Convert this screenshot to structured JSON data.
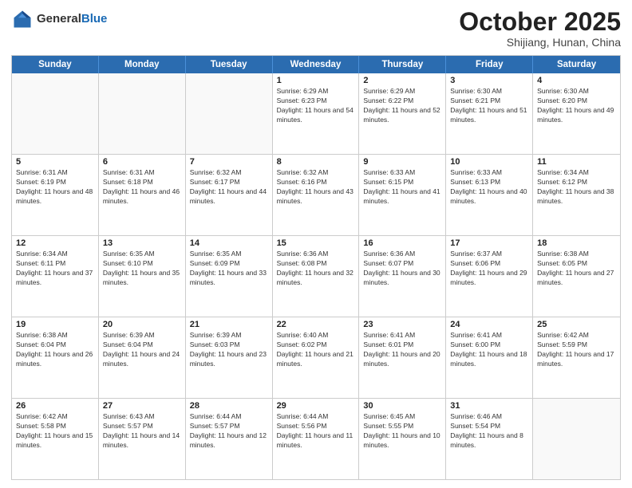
{
  "header": {
    "logo_general": "General",
    "logo_blue": "Blue",
    "month_title": "October 2025",
    "location": "Shijiang, Hunan, China"
  },
  "weekdays": [
    "Sunday",
    "Monday",
    "Tuesday",
    "Wednesday",
    "Thursday",
    "Friday",
    "Saturday"
  ],
  "rows": [
    [
      {
        "day": "",
        "sunrise": "",
        "sunset": "",
        "daylight": ""
      },
      {
        "day": "",
        "sunrise": "",
        "sunset": "",
        "daylight": ""
      },
      {
        "day": "",
        "sunrise": "",
        "sunset": "",
        "daylight": ""
      },
      {
        "day": "1",
        "sunrise": "Sunrise: 6:29 AM",
        "sunset": "Sunset: 6:23 PM",
        "daylight": "Daylight: 11 hours and 54 minutes."
      },
      {
        "day": "2",
        "sunrise": "Sunrise: 6:29 AM",
        "sunset": "Sunset: 6:22 PM",
        "daylight": "Daylight: 11 hours and 52 minutes."
      },
      {
        "day": "3",
        "sunrise": "Sunrise: 6:30 AM",
        "sunset": "Sunset: 6:21 PM",
        "daylight": "Daylight: 11 hours and 51 minutes."
      },
      {
        "day": "4",
        "sunrise": "Sunrise: 6:30 AM",
        "sunset": "Sunset: 6:20 PM",
        "daylight": "Daylight: 11 hours and 49 minutes."
      }
    ],
    [
      {
        "day": "5",
        "sunrise": "Sunrise: 6:31 AM",
        "sunset": "Sunset: 6:19 PM",
        "daylight": "Daylight: 11 hours and 48 minutes."
      },
      {
        "day": "6",
        "sunrise": "Sunrise: 6:31 AM",
        "sunset": "Sunset: 6:18 PM",
        "daylight": "Daylight: 11 hours and 46 minutes."
      },
      {
        "day": "7",
        "sunrise": "Sunrise: 6:32 AM",
        "sunset": "Sunset: 6:17 PM",
        "daylight": "Daylight: 11 hours and 44 minutes."
      },
      {
        "day": "8",
        "sunrise": "Sunrise: 6:32 AM",
        "sunset": "Sunset: 6:16 PM",
        "daylight": "Daylight: 11 hours and 43 minutes."
      },
      {
        "day": "9",
        "sunrise": "Sunrise: 6:33 AM",
        "sunset": "Sunset: 6:15 PM",
        "daylight": "Daylight: 11 hours and 41 minutes."
      },
      {
        "day": "10",
        "sunrise": "Sunrise: 6:33 AM",
        "sunset": "Sunset: 6:13 PM",
        "daylight": "Daylight: 11 hours and 40 minutes."
      },
      {
        "day": "11",
        "sunrise": "Sunrise: 6:34 AM",
        "sunset": "Sunset: 6:12 PM",
        "daylight": "Daylight: 11 hours and 38 minutes."
      }
    ],
    [
      {
        "day": "12",
        "sunrise": "Sunrise: 6:34 AM",
        "sunset": "Sunset: 6:11 PM",
        "daylight": "Daylight: 11 hours and 37 minutes."
      },
      {
        "day": "13",
        "sunrise": "Sunrise: 6:35 AM",
        "sunset": "Sunset: 6:10 PM",
        "daylight": "Daylight: 11 hours and 35 minutes."
      },
      {
        "day": "14",
        "sunrise": "Sunrise: 6:35 AM",
        "sunset": "Sunset: 6:09 PM",
        "daylight": "Daylight: 11 hours and 33 minutes."
      },
      {
        "day": "15",
        "sunrise": "Sunrise: 6:36 AM",
        "sunset": "Sunset: 6:08 PM",
        "daylight": "Daylight: 11 hours and 32 minutes."
      },
      {
        "day": "16",
        "sunrise": "Sunrise: 6:36 AM",
        "sunset": "Sunset: 6:07 PM",
        "daylight": "Daylight: 11 hours and 30 minutes."
      },
      {
        "day": "17",
        "sunrise": "Sunrise: 6:37 AM",
        "sunset": "Sunset: 6:06 PM",
        "daylight": "Daylight: 11 hours and 29 minutes."
      },
      {
        "day": "18",
        "sunrise": "Sunrise: 6:38 AM",
        "sunset": "Sunset: 6:05 PM",
        "daylight": "Daylight: 11 hours and 27 minutes."
      }
    ],
    [
      {
        "day": "19",
        "sunrise": "Sunrise: 6:38 AM",
        "sunset": "Sunset: 6:04 PM",
        "daylight": "Daylight: 11 hours and 26 minutes."
      },
      {
        "day": "20",
        "sunrise": "Sunrise: 6:39 AM",
        "sunset": "Sunset: 6:04 PM",
        "daylight": "Daylight: 11 hours and 24 minutes."
      },
      {
        "day": "21",
        "sunrise": "Sunrise: 6:39 AM",
        "sunset": "Sunset: 6:03 PM",
        "daylight": "Daylight: 11 hours and 23 minutes."
      },
      {
        "day": "22",
        "sunrise": "Sunrise: 6:40 AM",
        "sunset": "Sunset: 6:02 PM",
        "daylight": "Daylight: 11 hours and 21 minutes."
      },
      {
        "day": "23",
        "sunrise": "Sunrise: 6:41 AM",
        "sunset": "Sunset: 6:01 PM",
        "daylight": "Daylight: 11 hours and 20 minutes."
      },
      {
        "day": "24",
        "sunrise": "Sunrise: 6:41 AM",
        "sunset": "Sunset: 6:00 PM",
        "daylight": "Daylight: 11 hours and 18 minutes."
      },
      {
        "day": "25",
        "sunrise": "Sunrise: 6:42 AM",
        "sunset": "Sunset: 5:59 PM",
        "daylight": "Daylight: 11 hours and 17 minutes."
      }
    ],
    [
      {
        "day": "26",
        "sunrise": "Sunrise: 6:42 AM",
        "sunset": "Sunset: 5:58 PM",
        "daylight": "Daylight: 11 hours and 15 minutes."
      },
      {
        "day": "27",
        "sunrise": "Sunrise: 6:43 AM",
        "sunset": "Sunset: 5:57 PM",
        "daylight": "Daylight: 11 hours and 14 minutes."
      },
      {
        "day": "28",
        "sunrise": "Sunrise: 6:44 AM",
        "sunset": "Sunset: 5:57 PM",
        "daylight": "Daylight: 11 hours and 12 minutes."
      },
      {
        "day": "29",
        "sunrise": "Sunrise: 6:44 AM",
        "sunset": "Sunset: 5:56 PM",
        "daylight": "Daylight: 11 hours and 11 minutes."
      },
      {
        "day": "30",
        "sunrise": "Sunrise: 6:45 AM",
        "sunset": "Sunset: 5:55 PM",
        "daylight": "Daylight: 11 hours and 10 minutes."
      },
      {
        "day": "31",
        "sunrise": "Sunrise: 6:46 AM",
        "sunset": "Sunset: 5:54 PM",
        "daylight": "Daylight: 11 hours and 8 minutes."
      },
      {
        "day": "",
        "sunrise": "",
        "sunset": "",
        "daylight": ""
      }
    ]
  ]
}
